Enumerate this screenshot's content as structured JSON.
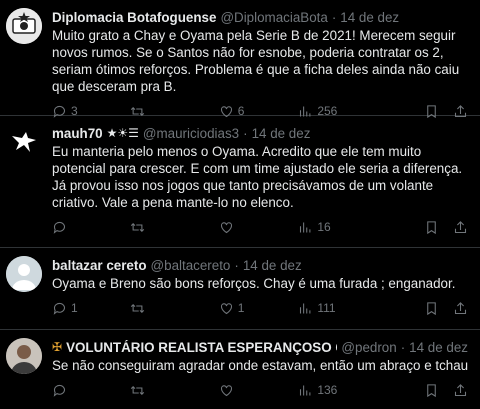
{
  "tweets": [
    {
      "name": "Diplomacia Botafoguense",
      "handle": "@DiplomaciaBota",
      "date": "14 de dez",
      "text": "Muito grato a Chay e Oyama pela Serie B de 2021! Merecem seguir novos rumos. Se o Santos não for esnobe, poderia contratar os 2, seriam ótimos reforços. Problema é que a ficha deles ainda não caiu que desceram pra B.",
      "replies": "3",
      "retweets": "",
      "likes": "6",
      "views": "256",
      "avatar": "star-badge"
    },
    {
      "name": "mauh70",
      "handle": "@mauriciodias3",
      "date": "14 de dez",
      "text": "Eu manteria pelo menos o Oyama. Acredito que ele tem muito potencial para crescer. E com um time ajustado ele seria a diferença. Já provou isso nos jogos que tanto precisávamos  de um volante criativo. Vale a pena mante-lo no elenco.",
      "replies": "",
      "retweets": "",
      "likes": "",
      "views": "16",
      "avatar": "bird-logo"
    },
    {
      "name": "baltazar cereto",
      "handle": "@baltacereto",
      "date": "14 de dez",
      "text": "Oyama e Breno são bons reforços. Chay é uma furada ; enganador.",
      "replies": "1",
      "retweets": "",
      "likes": "1",
      "views": "111",
      "avatar": "default-person"
    },
    {
      "name": "VOLUNTÁRIO REALISTA ESPERANÇOSO GLO",
      "handle": "@pedron",
      "date": "14 de dez",
      "text": "Se não conseguiram agradar onde estavam, então um abraço e tchau...",
      "replies": "",
      "retweets": "",
      "likes": "",
      "views": "136",
      "avatar": "person-photo"
    }
  ],
  "colors": {
    "bg": "#000000",
    "text": "#e7e9ea",
    "muted": "#71767b",
    "border": "#2f3336"
  }
}
